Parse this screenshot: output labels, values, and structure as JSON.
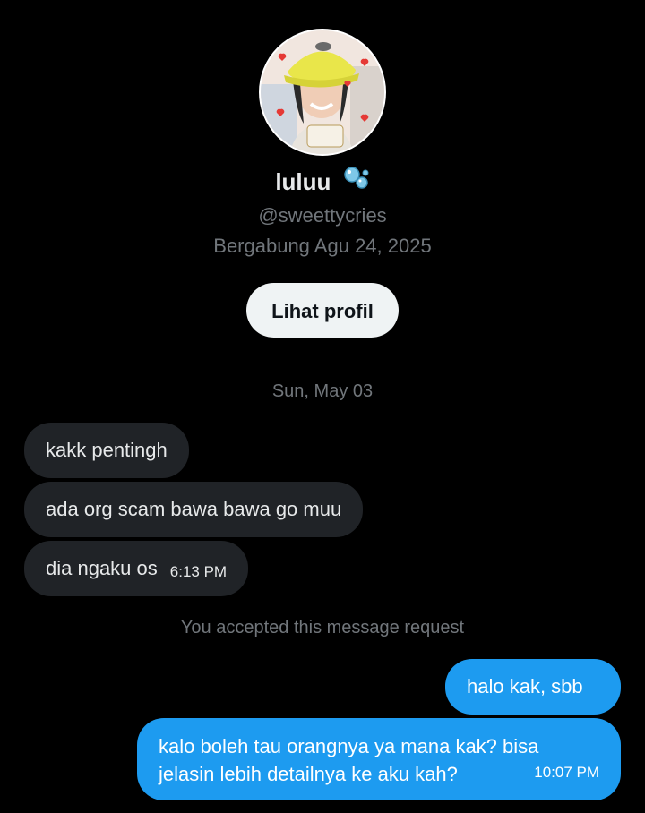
{
  "profile": {
    "name": "luluu",
    "emoji_icon": "bubbles-icon",
    "handle": "@sweettycries",
    "joined": "Bergabung Agu 24, 2025",
    "view_profile_label": "Lihat profil"
  },
  "thread": {
    "date_separator": "Sun, May 03",
    "incoming": [
      {
        "text": "kakk pentingh",
        "time": ""
      },
      {
        "text": "ada org scam bawa bawa go muu",
        "time": ""
      },
      {
        "text": "dia ngaku os",
        "time": "6:13 PM"
      }
    ],
    "request_notice": "You accepted this message request",
    "outgoing": [
      {
        "text": "halo kak, sbb",
        "time": ""
      },
      {
        "line1": "kalo boleh tau orangnya ya mana kak? bisa",
        "line2": "jelasin lebih detailnya ke aku kah?",
        "time": "10:07 PM"
      }
    ]
  },
  "colors": {
    "background": "#000000",
    "incoming_bubble": "#202327",
    "outgoing_bubble": "#1d9bf0",
    "muted_text": "#71767b",
    "button_bg": "#eff3f4"
  }
}
